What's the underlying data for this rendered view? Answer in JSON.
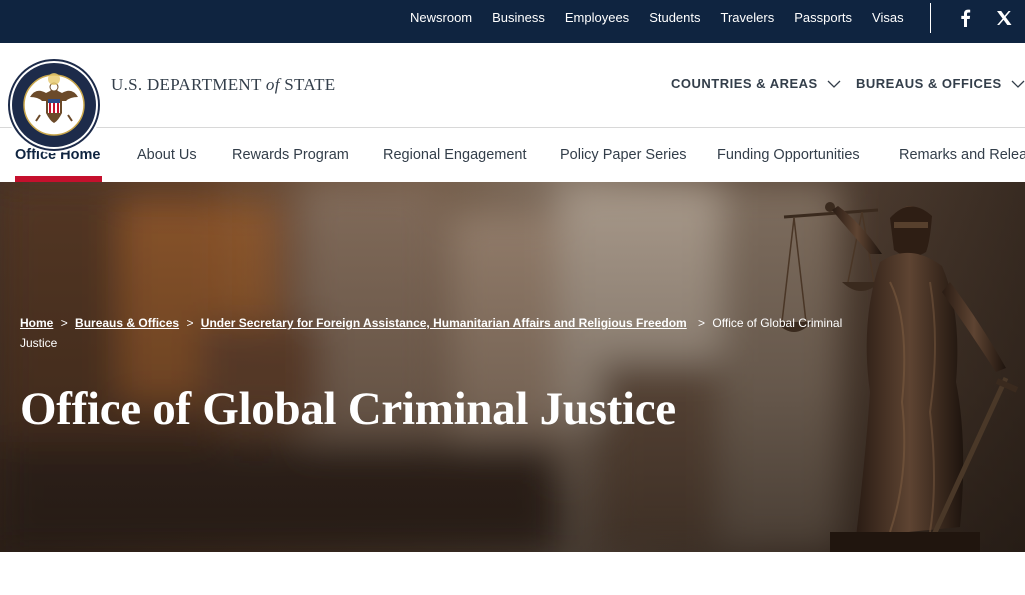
{
  "utility_nav": {
    "links": [
      "Newsroom",
      "Business",
      "Employees",
      "Students",
      "Travelers",
      "Passports",
      "Visas"
    ],
    "social": [
      "facebook-icon",
      "x-icon"
    ]
  },
  "header": {
    "site_name_pre": "U.S. DEPARTMENT ",
    "site_name_of": "of",
    "site_name_post": " STATE",
    "seal_icon": "department-of-state-seal",
    "nav": {
      "countries": "COUNTRIES & AREAS",
      "bureaus": "BUREAUS & OFFICES"
    }
  },
  "subnav": {
    "items": [
      "Office Home",
      "About Us",
      "Rewards Program",
      "Regional Engagement",
      "Policy Paper Series",
      "Funding Opportunities",
      "Remarks and Relea"
    ],
    "active_index": 0
  },
  "hero": {
    "breadcrumb": {
      "home": "Home",
      "sep": ">",
      "bureaus": "Bureaus & Offices",
      "under_secretary": "Under Secretary for Foreign Assistance, Humanitarian Affairs and Religious Freedom",
      "current": "Office of Global Criminal Justice"
    },
    "title": "Office of Global Criminal Justice",
    "image_icon": "lady-justice-statue"
  },
  "colors": {
    "navy": "#0f2440",
    "accent_red": "#c5102d",
    "text_dark": "#333e4a"
  }
}
